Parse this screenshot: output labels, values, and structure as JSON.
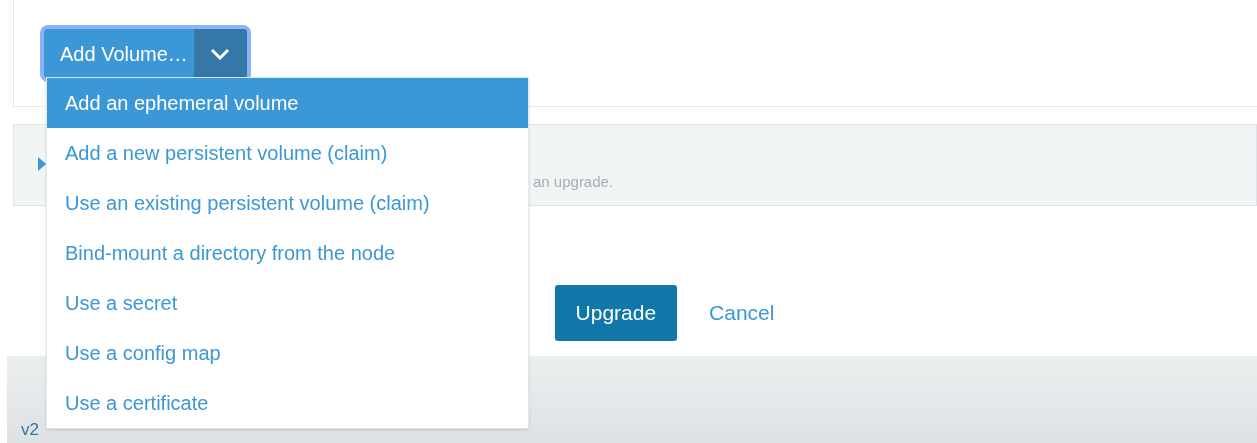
{
  "add_volume": {
    "label": "Add Volume…",
    "menu_items": [
      {
        "label": "Add an ephemeral volume",
        "selected": true
      },
      {
        "label": "Add a new persistent volume (claim)",
        "selected": false
      },
      {
        "label": "Use an existing persistent volume (claim)",
        "selected": false
      },
      {
        "label": "Bind-mount a directory from the node",
        "selected": false
      },
      {
        "label": "Use a secret",
        "selected": false
      },
      {
        "label": "Use a config map",
        "selected": false
      },
      {
        "label": "Use a certificate",
        "selected": false
      }
    ]
  },
  "section": {
    "description": "an upgrade."
  },
  "actions": {
    "primary": "Upgrade",
    "secondary": "Cancel"
  },
  "footer": {
    "version": "v2"
  }
}
